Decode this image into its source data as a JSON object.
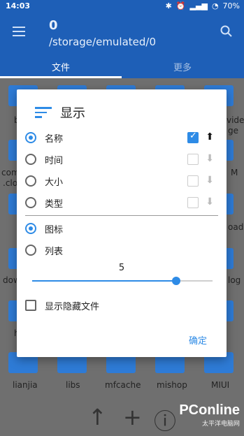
{
  "status_bar": {
    "time": "14:03",
    "battery": "70%"
  },
  "app_bar": {
    "count": "0",
    "path": "/storage/emulated/0"
  },
  "tabs": [
    {
      "label": "文件"
    },
    {
      "label": "更多"
    }
  ],
  "background_labels": {
    "top_left": "b",
    "top_right": "vide",
    "top_right2": "ge",
    "mid_left_1": "com",
    "mid_left_2": ".clou",
    "mid_right": "M",
    "right_oad": "oad",
    "left_dow": "dow",
    "right_log": "log",
    "left_h": "h",
    "bottom_row": [
      "lianjia",
      "libs",
      "mfcache",
      "mishop",
      "MIUI"
    ]
  },
  "dialog": {
    "title": "显示",
    "sort_options": [
      {
        "label": "名称",
        "selected": true,
        "checked": true,
        "arrow": "⬆"
      },
      {
        "label": "时间",
        "selected": false,
        "checked": false,
        "arrow": "⬇"
      },
      {
        "label": "大小",
        "selected": false,
        "checked": false,
        "arrow": "⬇"
      },
      {
        "label": "类型",
        "selected": false,
        "checked": false,
        "arrow": "⬇"
      }
    ],
    "view_options": [
      {
        "label": "图标",
        "selected": true
      },
      {
        "label": "列表",
        "selected": false
      }
    ],
    "slider": {
      "value": "5",
      "fill_fraction": 0.8
    },
    "show_hidden_label": "显示隐藏文件",
    "confirm_label": "确定"
  },
  "bottom_bar": {
    "up": "↑",
    "add": "+",
    "info": "ⓘ"
  },
  "watermark": {
    "brand": "PConline",
    "sub": "太平洋电脑网"
  },
  "colors": {
    "primary": "#1e5fb7",
    "accent": "#2e8be6"
  }
}
